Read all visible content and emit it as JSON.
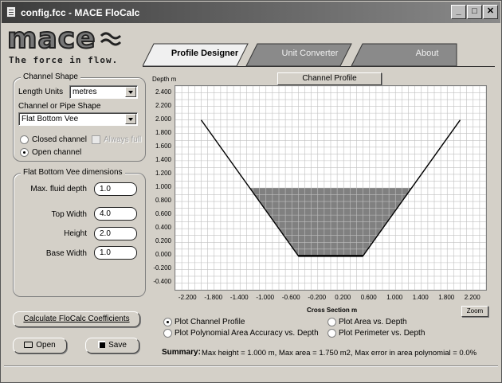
{
  "window": {
    "title": "config.fcc - MACE FloCalc",
    "controls": [
      "_",
      "□",
      "✕"
    ]
  },
  "logo": {
    "word": "mace",
    "tagline": "The force in flow."
  },
  "tabs": [
    {
      "label": "Profile Designer",
      "active": true
    },
    {
      "label": "Unit Converter",
      "active": false
    },
    {
      "label": "About",
      "active": false
    }
  ],
  "channel_shape": {
    "legend": "Channel Shape",
    "length_units_label": "Length Units",
    "length_units_value": "metres",
    "shape_label": "Channel or Pipe Shape",
    "shape_value": "Flat Bottom Vee",
    "closed_label": "Closed channel",
    "always_full_label": "Always full",
    "open_label": "Open channel"
  },
  "dimensions": {
    "legend": "Flat Bottom Vee dimensions",
    "fields": [
      {
        "label": "Max. fluid depth",
        "value": "1.0"
      },
      {
        "label": "Top Width",
        "value": "4.0"
      },
      {
        "label": "Height",
        "value": "2.0"
      },
      {
        "label": "Base Width",
        "value": "1.0"
      }
    ]
  },
  "buttons": {
    "calculate": "Calculate FloCalc Coefficients",
    "open": "Open",
    "save": "Save",
    "channel_profile": "Channel Profile",
    "zoom": "Zoom"
  },
  "plot_options": [
    {
      "label": "Plot Channel Profile",
      "selected": true
    },
    {
      "label": "Plot Area vs. Depth",
      "selected": false
    },
    {
      "label": "Plot Polynomial Area Accuracy vs. Depth",
      "selected": false
    },
    {
      "label": "Plot Perimeter vs. Depth",
      "selected": false
    }
  ],
  "summary": {
    "label": "Summary:",
    "text": "Max height = 1.000 m, Max area = 1.750 m2, Max error in area polynomial = 0.0%"
  },
  "chart_data": {
    "type": "area",
    "xlabel": "Cross Section m",
    "ylabel": "Depth m",
    "xlim": [
      -2.4,
      2.4
    ],
    "ylim": [
      -0.5,
      2.5
    ],
    "xticks": [
      "-2.200",
      "-1.800",
      "-1.400",
      "-1.000",
      "-0.600",
      "-0.200",
      "0.200",
      "0.600",
      "1.000",
      "1.400",
      "1.800",
      "2.200"
    ],
    "xtick_values": [
      -2.2,
      -1.8,
      -1.4,
      -1.0,
      -0.6,
      -0.2,
      0.2,
      0.6,
      1.0,
      1.4,
      1.8,
      2.2
    ],
    "yticks": [
      "2.400",
      "2.200",
      "2.000",
      "1.800",
      "1.600",
      "1.400",
      "1.200",
      "1.000",
      "0.800",
      "0.600",
      "0.400",
      "0.200",
      "0.000",
      "-0.200",
      "-0.400"
    ],
    "ytick_values": [
      2.4,
      2.2,
      2.0,
      1.8,
      1.6,
      1.4,
      1.2,
      1.0,
      0.8,
      0.6,
      0.4,
      0.2,
      0.0,
      -0.2,
      -0.4
    ],
    "grid": true,
    "channel_outline": {
      "x": [
        -2.0,
        -0.5,
        0.5,
        2.0
      ],
      "y": [
        2.0,
        0.0,
        0.0,
        2.0
      ]
    },
    "fluid_fill": {
      "x": [
        -1.25,
        -0.5,
        0.5,
        1.25
      ],
      "y": [
        1.0,
        0.0,
        0.0,
        1.0
      ]
    },
    "colors": {
      "fluid": "#808080",
      "channel": "#ffffff",
      "grid": "#c0c0c0",
      "outline": "#000000"
    }
  }
}
